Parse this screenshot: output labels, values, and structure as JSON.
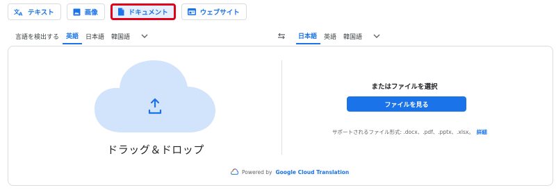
{
  "mode_tabs": [
    {
      "label": "テキスト",
      "icon": "translate-icon"
    },
    {
      "label": "画像",
      "icon": "image-icon"
    },
    {
      "label": "ドキュメント",
      "icon": "document-icon",
      "active": true
    },
    {
      "label": "ウェブサイト",
      "icon": "website-icon"
    }
  ],
  "source_langs": [
    "言語を検出する",
    "英語",
    "日本語",
    "韓国語"
  ],
  "source_selected": "英語",
  "target_langs": [
    "日本語",
    "英語",
    "韓国語"
  ],
  "target_selected": "日本語",
  "upload": {
    "drop_text": "ドラッグ＆ドロップ",
    "or_title": "またはファイルを選択",
    "browse_label": "ファイルを見る",
    "formats_text": "サポートされるファイル形式: .docx、.pdf、.pptx、.xlsx。",
    "details_link": "詳細"
  },
  "footer": {
    "powered_by": "Powered by",
    "brand": "Google Cloud Translation"
  },
  "colors": {
    "accent": "#1a73e8",
    "highlight": "#e0001a",
    "cloud": "#d2e3fc"
  }
}
